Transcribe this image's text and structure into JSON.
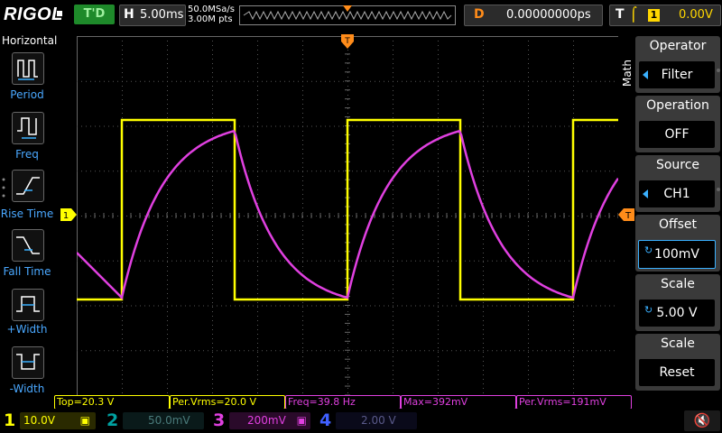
{
  "brand": "RIGOL",
  "status": "T'D",
  "horizontal": {
    "key": "H",
    "value": "5.00ms",
    "sample_rate": "50.0MSa/s",
    "points": "3.00M pts"
  },
  "delay": {
    "key": "D",
    "value": "0.00000000ps"
  },
  "trigger": {
    "key": "T",
    "edge_icon": "rising-edge-icon",
    "source": "1",
    "level": "0.00V"
  },
  "left_panel": {
    "title": "Horizontal",
    "items": [
      {
        "label": "Period",
        "icon": "period-icon"
      },
      {
        "label": "Freq",
        "icon": "frequency-icon"
      },
      {
        "label": "Rise Time",
        "icon": "rise-time-icon"
      },
      {
        "label": "Fall Time",
        "icon": "fall-time-icon"
      },
      {
        "label": "+Width",
        "icon": "positive-width-icon"
      },
      {
        "label": "-Width",
        "icon": "negative-width-icon"
      }
    ]
  },
  "right_panel": {
    "side_label": "Math",
    "menu": [
      {
        "title": "Operator",
        "value": "Filter"
      },
      {
        "title": "Operation",
        "value": "OFF"
      },
      {
        "title": "Source",
        "value": "CH1"
      },
      {
        "title": "Offset",
        "value": "100mV"
      },
      {
        "title": "Scale",
        "value": "5.00 V"
      },
      {
        "title": "Scale",
        "value": "Reset"
      }
    ]
  },
  "markers": {
    "ch1": "1",
    "trigger": "T"
  },
  "measurements": [
    {
      "text": "Top=20.3 V",
      "color": "#ffff00"
    },
    {
      "text": "Per.Vrms=20.0 V",
      "color": "#ffff00"
    },
    {
      "text": "Freq=39.8 Hz",
      "color": "#e040e0"
    },
    {
      "text": "Max=392mV",
      "color": "#e040e0"
    },
    {
      "text": "Per.Vrms=191mV",
      "color": "#e040e0"
    }
  ],
  "channels": [
    {
      "num": "1",
      "scale": "10.0V",
      "color": "#ffff00",
      "active": true
    },
    {
      "num": "2",
      "scale": "50.0mV",
      "color": "#00a0a0",
      "active": false
    },
    {
      "num": "3",
      "scale": "200mV",
      "color": "#e040e0",
      "active": true
    },
    {
      "num": "4",
      "scale": "2.00 V",
      "color": "#4060ff",
      "active": false
    }
  ],
  "waveform_colors": {
    "ch1": "#ffff00",
    "math": "#e040e0"
  },
  "icons": {
    "sound": "speaker-mute-icon"
  }
}
